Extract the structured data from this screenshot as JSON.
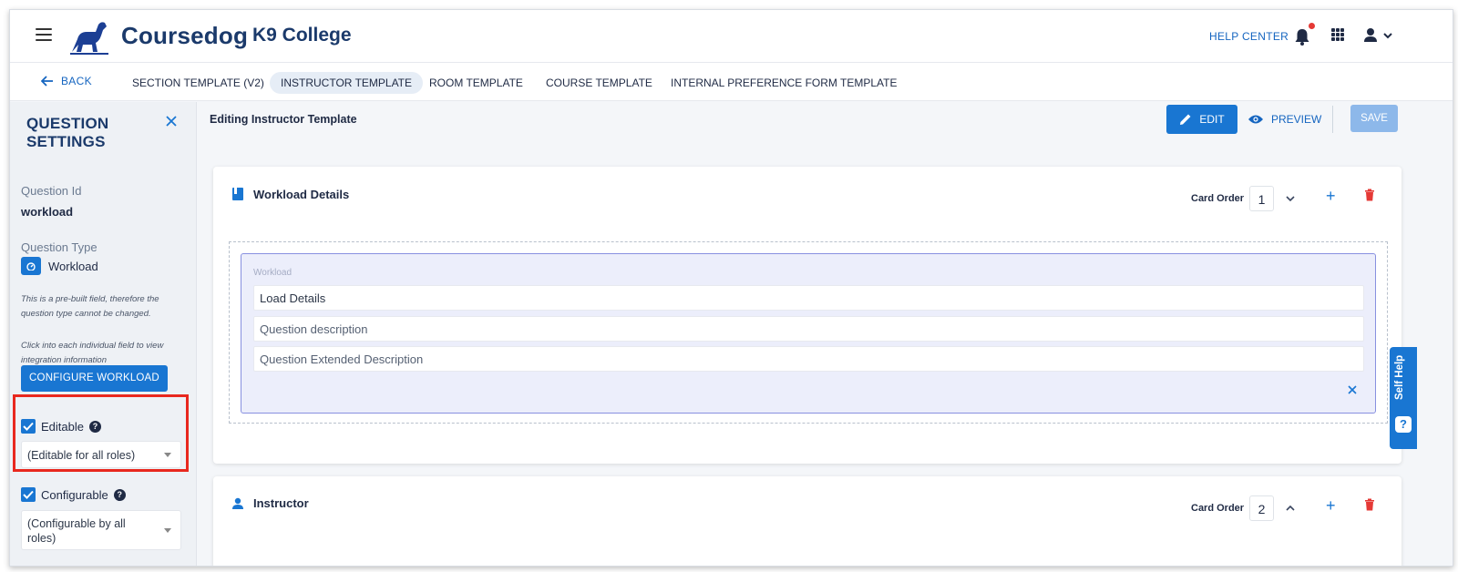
{
  "header": {
    "brand": "Coursedog",
    "institution": "K9 College",
    "help_center": "HELP CENTER",
    "icons": [
      "menu-icon",
      "dog-logo-icon",
      "bell-icon",
      "apps-grid-icon",
      "user-icon",
      "chevron-down-icon"
    ],
    "notification_dot_color": "#e53935"
  },
  "nav": {
    "back_label": "BACK",
    "tabs": [
      {
        "label": "SECTION TEMPLATE (V2)"
      },
      {
        "label": "INSTRUCTOR TEMPLATE",
        "active": true
      },
      {
        "label": "ROOM TEMPLATE"
      },
      {
        "label": "COURSE TEMPLATE"
      },
      {
        "label": "INTERNAL PREFERENCE FORM TEMPLATE"
      }
    ]
  },
  "sidebar": {
    "title_line1": "QUESTION",
    "title_line2": "SETTINGS",
    "question_id_label": "Question Id",
    "question_id_value": "workload",
    "question_type_label": "Question Type",
    "question_type_value": "Workload",
    "note_prebuilt": "This is a pre-built field, therefore the question type cannot be changed.",
    "note_click": "Click into each individual field to view integration information",
    "configure_button": "CONFIGURE WORKLOAD",
    "editable_label": "Editable",
    "editable_checked": true,
    "editable_select": "(Editable for all roles)",
    "configurable_label": "Configurable",
    "configurable_checked": true,
    "configurable_select": "(Configurable by all roles)",
    "highlight_color": "#e8281e"
  },
  "main": {
    "editing_title": "Editing Instructor Template",
    "edit_button": "EDIT",
    "preview_button": "PREVIEW",
    "save_button": "SAVE",
    "accent_color": "#1976d2",
    "cards": [
      {
        "title": "Workload Details",
        "icon": "book-icon",
        "card_order_label": "Card Order",
        "card_order_value": "1",
        "question": {
          "label": "Workload",
          "fields": [
            "Load Details",
            "Question description",
            "Question Extended Description"
          ]
        }
      },
      {
        "title": "Instructor",
        "icon": "person-icon",
        "card_order_label": "Card Order",
        "card_order_value": "2"
      }
    ]
  },
  "self_help": {
    "label": "Self Help"
  }
}
